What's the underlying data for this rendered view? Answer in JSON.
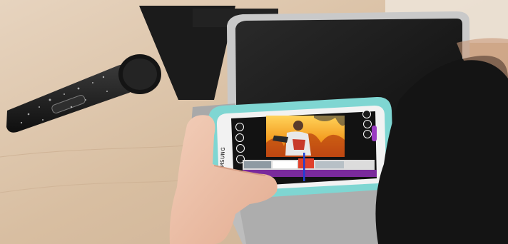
{
  "photo": {
    "phone_brand_text": "SAMSUNG"
  },
  "colors": {
    "desk": "#d9c2a8",
    "phone_case": "#7fd6d2",
    "video_accent": "#f2a81a",
    "timeline_purple": "#7a2a9c",
    "playhead": "#1f3fd6",
    "tablet_frame": "#c9c9c9"
  },
  "icons": [
    "back-icon",
    "undo-icon",
    "audio-icon",
    "text-icon",
    "play-icon",
    "share-icon",
    "settings-icon",
    "record-icon"
  ]
}
